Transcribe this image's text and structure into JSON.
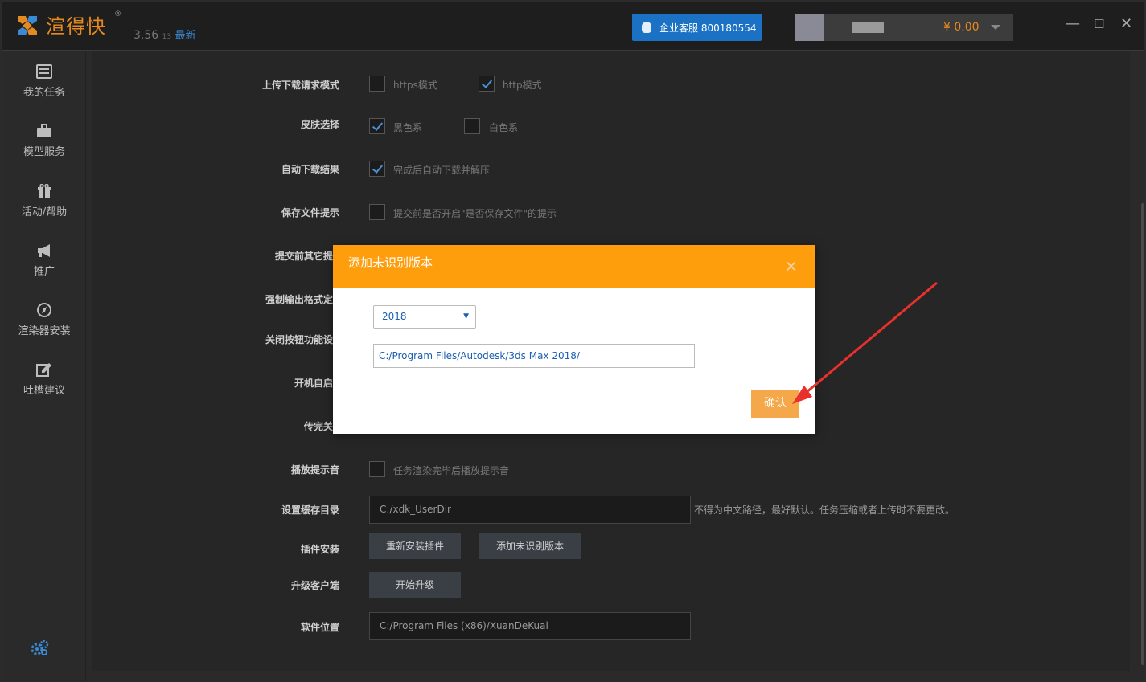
{
  "app": {
    "name": "渲得快",
    "registered": "®",
    "version_major": "3.56",
    "version_minor": "13",
    "version_tag": "最新"
  },
  "header": {
    "support_label": "企业客服 800180554",
    "balance": "¥ 0.00"
  },
  "window_controls": {
    "minimize": "—",
    "maximize": "☐",
    "close": "✕"
  },
  "sidebar": {
    "items": [
      {
        "label": "我的任务",
        "icon": "task-list-icon"
      },
      {
        "label": "模型服务",
        "icon": "briefcase-icon"
      },
      {
        "label": "活动/帮助",
        "icon": "gift-icon"
      },
      {
        "label": "推广",
        "icon": "megaphone-icon"
      },
      {
        "label": "渲染器安装",
        "icon": "compass-icon"
      },
      {
        "label": "吐槽建议",
        "icon": "edit-icon"
      }
    ],
    "settings_icon": "gear-icon"
  },
  "settings": {
    "upload_mode": {
      "label": "上传下载请求模式",
      "opt1": "https模式",
      "opt2": "http模式",
      "opt1_checked": false,
      "opt2_checked": true
    },
    "skin": {
      "label": "皮肤选择",
      "opt1": "黑色系",
      "opt2": "白色系",
      "opt1_checked": true,
      "opt2_checked": false
    },
    "auto_download": {
      "label": "自动下载结果",
      "opt": "完成后自动下载并解压",
      "checked": true
    },
    "save_file_tip": {
      "label": "保存文件提示",
      "opt": "提交前是否开启\"是否保存文件\"的提示",
      "checked": false
    },
    "pre_submit": {
      "label": "提交前其它提"
    },
    "force_output": {
      "label": "强制输出格式定"
    },
    "close_button": {
      "label": "关闭按钮功能设"
    },
    "autostart": {
      "label": "开机自启"
    },
    "finish_close": {
      "label": "传完关"
    },
    "play_sound": {
      "label": "播放提示音",
      "opt": "任务渲染完毕后播放提示音",
      "checked": false
    },
    "cache_dir": {
      "label": "设置缓存目录",
      "value": "C:/xdk_UserDir",
      "note": "不得为中文路径，最好默认。任务压缩或者上传时不要更改。"
    },
    "plugins": {
      "label": "插件安装",
      "reinstall": "重新安装插件",
      "add_version": "添加未识别版本"
    },
    "upgrade": {
      "label": "升级客户端",
      "button": "开始升级"
    },
    "location": {
      "label": "软件位置",
      "value": "C:/Program Files (x86)/XuanDeKuai"
    }
  },
  "dialog": {
    "title": "添加未识别版本",
    "close": "×",
    "version_selected": "2018",
    "path_value": "C:/Program Files/Autodesk/3ds Max 2018/",
    "confirm_label": "确认"
  },
  "colors": {
    "accent_orange": "#ff9e0d",
    "confirm_orange": "#f4a84a",
    "support_blue": "#1b72c4",
    "annotation_red": "#e8302c"
  }
}
